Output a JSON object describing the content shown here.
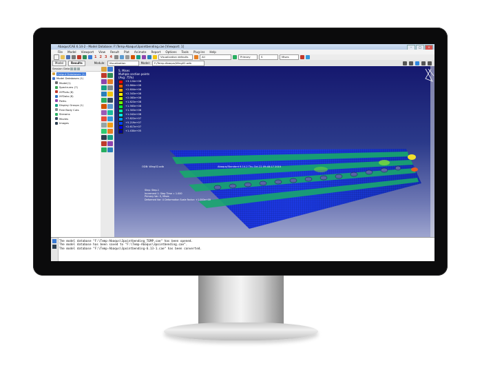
{
  "app": {
    "title": "Abaqus/CAE 6.14-2 - Model Database: F:\\Temp-Abaqus\\3pointbending.cae [Viewport: 1]"
  },
  "menu": [
    "File",
    "Model",
    "Viewport",
    "View",
    "Result",
    "Plot",
    "Animate",
    "Report",
    "Options",
    "Tools",
    "Plug-ins",
    "Help"
  ],
  "toolbar": {
    "numbers": [
      "1",
      "2",
      "3",
      "4"
    ],
    "visualization_defaults": "Visualization defaults",
    "all_value": "All",
    "primary_value": "Primary",
    "field_value": "S",
    "mises_value": "Mises"
  },
  "context": {
    "tabs": [
      "Model",
      "Results"
    ],
    "active_tab": "Results",
    "module_label": "Module:",
    "module_value": "Visualization",
    "model_label": "Model:",
    "model_value": "F:/Temp-Abaqus/Wing02.odb"
  },
  "tree": {
    "header": "Session Data",
    "items": [
      {
        "label": "Output Databases (1)",
        "selected": true,
        "color": "#d9a441"
      },
      {
        "label": "Model Databases (1)",
        "selected": false,
        "color": "#4a7bd0"
      },
      {
        "label": "Model(1)",
        "selected": false,
        "color": "#6a6a6a"
      },
      {
        "label": "Spectrums (7)",
        "selected": false,
        "color": "#3aa655"
      },
      {
        "label": "XYPlots (8)",
        "selected": false,
        "color": "#c0392b"
      },
      {
        "label": "XYData (8)",
        "selected": false,
        "color": "#2f74c0"
      },
      {
        "label": "Paths",
        "selected": false,
        "color": "#8e44ad"
      },
      {
        "label": "Display Groups (1)",
        "selected": false,
        "color": "#16a085"
      },
      {
        "label": "Free Body Cuts",
        "selected": false,
        "color": "#7f8c8d"
      },
      {
        "label": "Streams",
        "selected": false,
        "color": "#27ae60"
      },
      {
        "label": "Movies",
        "selected": false,
        "color": "#34495e"
      },
      {
        "label": "Images",
        "selected": false,
        "color": "#2c3e50"
      }
    ]
  },
  "legend": {
    "title": "S, Mises",
    "subtitle": "Multiple section points",
    "avg": "(Avg: 75%)",
    "values": [
      "+3.124e+08",
      "+2.864e+08",
      "+2.604e+08",
      "+2.343e+08",
      "+2.083e+08",
      "+1.823e+08",
      "+1.563e+08",
      "+1.303e+08",
      "+1.042e+08",
      "+7.822e+07",
      "+5.219e+07",
      "+2.617e+07",
      "+1.430e+05"
    ],
    "colors": [
      "#ff0000",
      "#ff5a00",
      "#ffa800",
      "#fff000",
      "#c8ff00",
      "#6eff00",
      "#00ff3c",
      "#00ffaa",
      "#00e6ff",
      "#0096ff",
      "#0046ff",
      "#0000e6",
      "#000096"
    ]
  },
  "viewport": {
    "odb_label": "ODB: Wing02.odb",
    "odb_info": "Abaqus/Standard 6.14-2  Thu Oct 22 09:48:17 2015",
    "step_lines": [
      "Step: Step-1",
      "Increment 1: Step Time = 1.000",
      "Primary Var: S, Mises",
      "Deformed Var: U  Deformation Scale Factor: +1.000e+00"
    ]
  },
  "messages": [
    "The model database \"F:\\Temp-Abaqus\\3pointbending_TEMP.cae\" has been opened.",
    "The model database has been saved to \"F:\\Temp-Abaqus\\3pointbending.cae\".",
    "The model database \"F:\\Temp-Abaqus\\3pointbending-6.13-1.cae\" has been converted."
  ]
}
